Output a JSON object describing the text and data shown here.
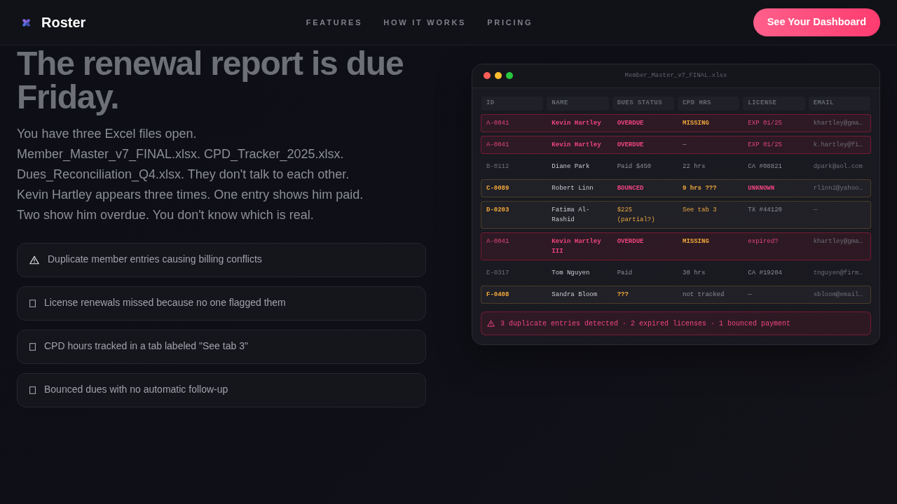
{
  "nav": {
    "brand": "Roster",
    "links": [
      {
        "label": "FEATURES"
      },
      {
        "label": "HOW IT WORKS"
      },
      {
        "label": "PRICING"
      }
    ],
    "cta": "See Your Dashboard"
  },
  "hero": {
    "title": "The renewal report is due Friday.",
    "paragraph_lines": [
      "You have three Excel files open.",
      "Member_Master_v7_FINAL.xlsx. CPD_Tracker_2025.xlsx.",
      "Dues_Reconciliation_Q4.xlsx. They don't talk to each other.",
      "Kevin Hartley appears three times. One entry shows him paid.",
      "Two show him overdue. You don't know which is real."
    ],
    "problems": [
      {
        "kind": "warning",
        "text": "Duplicate member entries causing billing conflicts"
      },
      {
        "kind": "blank",
        "text": "License renewals missed because no one flagged them"
      },
      {
        "kind": "blank",
        "text": "CPD hours tracked in a tab labeled \"See tab 3\""
      },
      {
        "kind": "blank",
        "text": "Bounced dues with no automatic follow-up"
      }
    ]
  },
  "spreadsheet": {
    "title": "Member_Master_v7_FINAL.xlsx",
    "columns": [
      "ID",
      "NAME",
      "DUES STATUS",
      "CPD HRS",
      "LICENSE",
      "EMAIL"
    ],
    "rows": [
      {
        "kind": "duplicate",
        "cells": [
          {
            "text": "A-0041",
            "kind": "alert"
          },
          {
            "text": "Kevin Hartley",
            "kind": "danger"
          },
          {
            "text": "OVERDUE",
            "kind": "danger"
          },
          {
            "text": "MISSING",
            "kind": "flag"
          },
          {
            "text": "EXP 01/25",
            "kind": "alert"
          },
          {
            "text": "khartley@gma…",
            "kind": "faint"
          }
        ]
      },
      {
        "kind": "duplicate",
        "cells": [
          {
            "text": "A-0041",
            "kind": "alert"
          },
          {
            "text": "Kevin Hartley",
            "kind": "danger"
          },
          {
            "text": "OVERDUE",
            "kind": "danger"
          },
          {
            "text": "—",
            "kind": "muted"
          },
          {
            "text": "EXP 01/25",
            "kind": "alert"
          },
          {
            "text": "k.hartley@fi…",
            "kind": "faint"
          }
        ]
      },
      {
        "kind": "ok",
        "cells": [
          {
            "text": "B-0112",
            "kind": "faint"
          },
          {
            "text": "Diane Park",
            "kind": "plain"
          },
          {
            "text": "Paid $450",
            "kind": "muted"
          },
          {
            "text": "22 hrs",
            "kind": "muted"
          },
          {
            "text": "CA #08821",
            "kind": "muted"
          },
          {
            "text": "dpark@aol.com",
            "kind": "faint"
          }
        ]
      },
      {
        "kind": "warning",
        "cells": [
          {
            "text": "C-0089",
            "kind": "flag"
          },
          {
            "text": "Robert Linn",
            "kind": "plain"
          },
          {
            "text": "BOUNCED",
            "kind": "danger"
          },
          {
            "text": "9 hrs ???",
            "kind": "flag"
          },
          {
            "text": "UNKNOWN",
            "kind": "danger"
          },
          {
            "text": "rlinn2@yahoo…",
            "kind": "faint"
          }
        ]
      },
      {
        "kind": "warning",
        "cells": [
          {
            "text": "D-0203",
            "kind": "flag"
          },
          {
            "text": "Fatima Al-Rashid",
            "kind": "plain"
          },
          {
            "text": "$225 (partial?)",
            "kind": "caution"
          },
          {
            "text": "See tab 3",
            "kind": "caution"
          },
          {
            "text": "TX #44120",
            "kind": "muted"
          },
          {
            "text": "—",
            "kind": "faint"
          }
        ]
      },
      {
        "kind": "duplicate",
        "cells": [
          {
            "text": "A-0041",
            "kind": "alert"
          },
          {
            "text": "Kevin Hartley III",
            "kind": "danger"
          },
          {
            "text": "OVERDUE",
            "kind": "danger"
          },
          {
            "text": "MISSING",
            "kind": "flag"
          },
          {
            "text": "expired?",
            "kind": "alert"
          },
          {
            "text": "khartley@gma…",
            "kind": "faint"
          }
        ]
      },
      {
        "kind": "ok",
        "cells": [
          {
            "text": "E-0317",
            "kind": "faint"
          },
          {
            "text": "Tom Nguyen",
            "kind": "plain"
          },
          {
            "text": "Paid",
            "kind": "muted"
          },
          {
            "text": "30 hrs",
            "kind": "muted"
          },
          {
            "text": "CA #19204",
            "kind": "muted"
          },
          {
            "text": "tnguyen@firm…",
            "kind": "faint"
          }
        ]
      },
      {
        "kind": "warning",
        "cells": [
          {
            "text": "F-0408",
            "kind": "flag"
          },
          {
            "text": "Sandra Bloom",
            "kind": "plain"
          },
          {
            "text": "???",
            "kind": "flag"
          },
          {
            "text": "not tracked",
            "kind": "muted"
          },
          {
            "text": "—",
            "kind": "muted"
          },
          {
            "text": "sbloom@email…",
            "kind": "faint"
          }
        ]
      }
    ],
    "alert": "3 duplicate entries detected · 2 expired licenses · 1 bounced payment"
  }
}
